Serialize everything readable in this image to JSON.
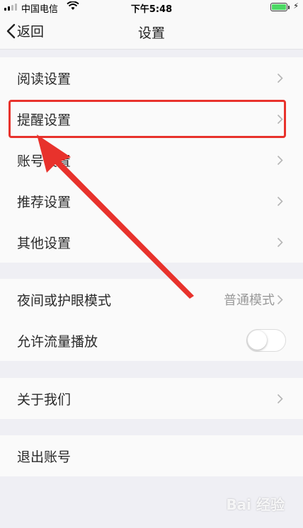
{
  "status_bar": {
    "carrier": "中国电信",
    "time": "下午5:48",
    "battery_level": 1.0,
    "battery_color": "#4cd964"
  },
  "nav": {
    "back_label": "返回",
    "title": "设置",
    "back_icon": "chevron-left-icon"
  },
  "groups": {
    "main": [
      {
        "label": "阅读设置"
      },
      {
        "label": "提醒设置",
        "highlighted": true
      },
      {
        "label": "账号设置"
      },
      {
        "label": "推荐设置"
      },
      {
        "label": "其他设置"
      }
    ],
    "display": {
      "night_mode_label": "夜间或护眼模式",
      "night_mode_value": "普通模式",
      "traffic_play_label": "允许流量播放",
      "traffic_play_enabled": false
    },
    "about": {
      "label": "关于我们"
    },
    "logout": {
      "label": "退出账号"
    }
  },
  "annotation": {
    "highlight_color": "#e8322c",
    "arrow_icon": "red-arrow-annotation"
  },
  "watermark": "Bai 经验"
}
